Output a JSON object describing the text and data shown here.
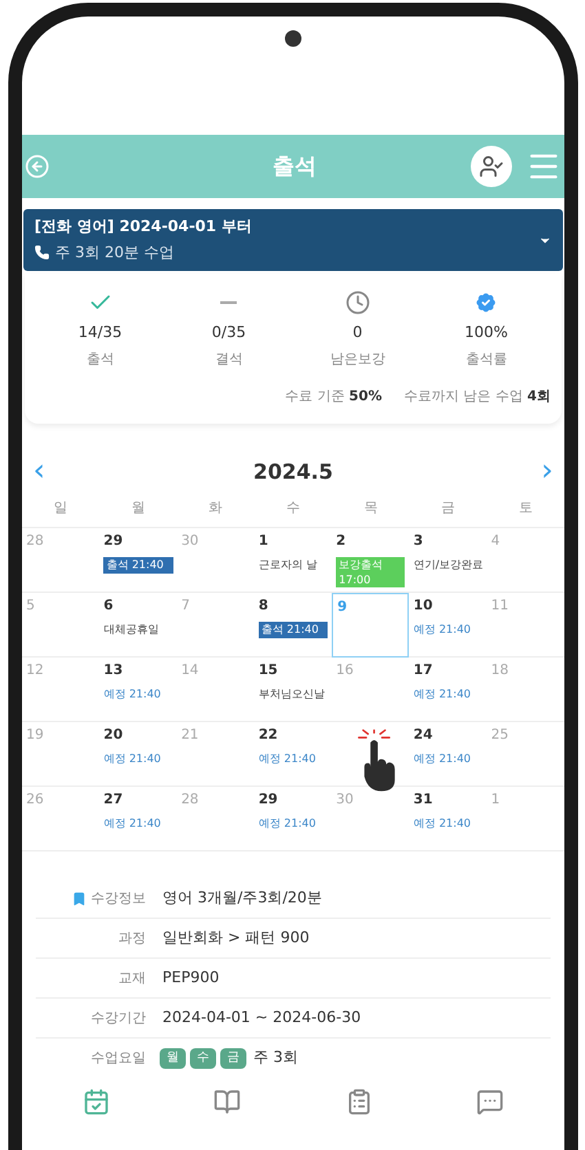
{
  "header": {
    "title": "출석"
  },
  "course_selector": {
    "title": "[전화 영어] 2024-04-01 부터",
    "subtitle": "주 3회 20분 수업"
  },
  "stats": [
    {
      "kind": "check",
      "value": "14/35",
      "label": "출석"
    },
    {
      "kind": "dash",
      "value": "0/35",
      "label": "결석"
    },
    {
      "kind": "clock",
      "value": "0",
      "label": "남은보강"
    },
    {
      "kind": "badge",
      "value": "100%",
      "label": "출석률"
    }
  ],
  "completion": [
    {
      "label": "수료 기준",
      "value": "50%"
    },
    {
      "label": "수료까지 남은 수업",
      "value": "4회"
    }
  ],
  "calendar": {
    "prev": "‹",
    "title": "2024.5",
    "next": "›",
    "weekdays": [
      "일",
      "월",
      "화",
      "수",
      "목",
      "금",
      "토"
    ],
    "weeks": [
      [
        {
          "day": "28",
          "emphasized": false,
          "selected": false
        },
        {
          "day": "29",
          "emphasized": true,
          "selected": false,
          "events": [
            {
              "kind": "attended",
              "text": "출석 21:40"
            }
          ]
        },
        {
          "day": "30",
          "emphasized": false,
          "selected": false
        },
        {
          "day": "1",
          "emphasized": true,
          "selected": false,
          "events": [
            {
              "kind": "note",
              "text": "근로자의 날"
            }
          ]
        },
        {
          "day": "2",
          "emphasized": true,
          "selected": false,
          "events": [
            {
              "kind": "makeup",
              "text": "보강출석 17:00"
            }
          ]
        },
        {
          "day": "3",
          "emphasized": true,
          "selected": false,
          "events": [
            {
              "kind": "note",
              "text": "연기/보강완료"
            }
          ]
        },
        {
          "day": "4",
          "emphasized": false,
          "selected": false
        }
      ],
      [
        {
          "day": "5",
          "emphasized": false,
          "selected": false
        },
        {
          "day": "6",
          "emphasized": true,
          "selected": false,
          "events": [
            {
              "kind": "note",
              "text": "대체공휴일"
            }
          ]
        },
        {
          "day": "7",
          "emphasized": false,
          "selected": false
        },
        {
          "day": "8",
          "emphasized": true,
          "selected": false,
          "events": [
            {
              "kind": "attended",
              "text": "출석 21:40"
            }
          ]
        },
        {
          "day": "9",
          "emphasized": true,
          "selected": true
        },
        {
          "day": "10",
          "emphasized": true,
          "selected": false,
          "events": [
            {
              "kind": "scheduled",
              "text": "예정 21:40"
            }
          ]
        },
        {
          "day": "11",
          "emphasized": false,
          "selected": false
        }
      ],
      [
        {
          "day": "12",
          "emphasized": false,
          "selected": false
        },
        {
          "day": "13",
          "emphasized": true,
          "selected": false,
          "events": [
            {
              "kind": "scheduled",
              "text": "예정 21:40"
            }
          ]
        },
        {
          "day": "14",
          "emphasized": false,
          "selected": false
        },
        {
          "day": "15",
          "emphasized": true,
          "selected": false,
          "events": [
            {
              "kind": "note",
              "text": "부처님오신날"
            }
          ]
        },
        {
          "day": "16",
          "emphasized": false,
          "selected": false
        },
        {
          "day": "17",
          "emphasized": true,
          "selected": false,
          "events": [
            {
              "kind": "scheduled",
              "text": "예정 21:40"
            }
          ]
        },
        {
          "day": "18",
          "emphasized": false,
          "selected": false
        }
      ],
      [
        {
          "day": "19",
          "emphasized": false,
          "selected": false
        },
        {
          "day": "20",
          "emphasized": true,
          "selected": false,
          "events": [
            {
              "kind": "scheduled",
              "text": "예정 21:40"
            }
          ]
        },
        {
          "day": "21",
          "emphasized": false,
          "selected": false
        },
        {
          "day": "22",
          "emphasized": true,
          "selected": false,
          "events": [
            {
              "kind": "scheduled",
              "text": "예정 21:40"
            }
          ]
        },
        {
          "emphasized": false,
          "selected": false
        },
        {
          "day": "24",
          "emphasized": true,
          "selected": false,
          "events": [
            {
              "kind": "scheduled",
              "text": "예정 21:40"
            }
          ]
        },
        {
          "day": "25",
          "emphasized": false,
          "selected": false
        }
      ],
      [
        {
          "day": "26",
          "emphasized": false,
          "selected": false
        },
        {
          "day": "27",
          "emphasized": true,
          "selected": false,
          "events": [
            {
              "kind": "scheduled",
              "text": "예정 21:40"
            }
          ]
        },
        {
          "day": "28",
          "emphasized": false,
          "selected": false
        },
        {
          "day": "29",
          "emphasized": true,
          "selected": false,
          "events": [
            {
              "kind": "scheduled",
              "text": "예정 21:40"
            }
          ]
        },
        {
          "day": "30",
          "emphasized": false,
          "selected": false
        },
        {
          "day": "31",
          "emphasized": true,
          "selected": false,
          "events": [
            {
              "kind": "scheduled",
              "text": "예정 21:40"
            }
          ]
        },
        {
          "day": "1",
          "emphasized": false,
          "selected": false
        }
      ]
    ]
  },
  "enrollment": [
    {
      "kind": "title",
      "label": "수강정보",
      "value": "영어 3개월/주3회/20분"
    },
    {
      "kind": "text",
      "label": "과정",
      "value": "일반회화 > 패턴 900"
    },
    {
      "kind": "text",
      "label": "교재",
      "value": "PEP900"
    },
    {
      "kind": "text",
      "label": "수강기간",
      "value": "2024-04-01 ~ 2024-06-30"
    },
    {
      "kind": "days",
      "label": "수업요일",
      "chips": [
        "월",
        "수",
        "금"
      ],
      "value": "주 3회"
    }
  ],
  "bottom_nav": [
    {
      "kind": "calendar",
      "selected": true
    },
    {
      "kind": "book",
      "selected": false
    },
    {
      "kind": "report",
      "selected": false
    },
    {
      "kind": "chat",
      "selected": false
    }
  ]
}
